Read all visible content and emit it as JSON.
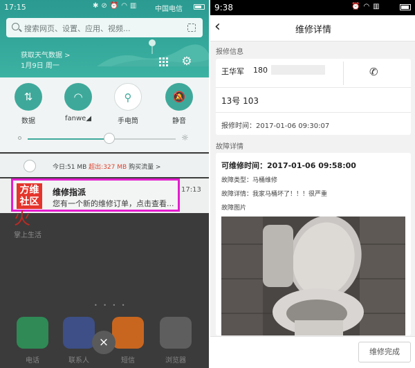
{
  "left_phone": {
    "status": {
      "time": "17:15",
      "carrier": "中国电信"
    },
    "search": {
      "placeholder": "搜索网页、设置、应用、视频..."
    },
    "weather_link": "获取天气数据 >",
    "date": "1月9日 周一",
    "quick_settings": [
      {
        "label": "数据",
        "active": true,
        "icon": "data-arrows-icon"
      },
      {
        "label": "fanwe",
        "active": true,
        "icon": "wifi-icon"
      },
      {
        "label": "手电筒",
        "active": false,
        "icon": "flashlight-icon"
      },
      {
        "label": "静音",
        "active": true,
        "icon": "bell-mute-icon"
      }
    ],
    "brightness": 0.55,
    "data_usage": {
      "today": "今日:51 MB",
      "exceeded": "超出:327 MB",
      "buy": "购买流量 >",
      "warn_color": "#e0422e"
    },
    "notification": {
      "app_logo": "方维社区",
      "title": "维修指派",
      "body": "您有一个新的维修订单，点击查看...",
      "time": "17:13",
      "highlight_color": "#e51ccf"
    },
    "background_app": {
      "name": "掌上生活"
    },
    "dock": [
      {
        "label": "电话",
        "color": "#2f8a55",
        "icon": "phone-icon"
      },
      {
        "label": "联系人",
        "color": "#3d4f86",
        "icon": "contacts-icon"
      },
      {
        "label": "短信",
        "color": "#c8661f",
        "icon": "message-icon"
      },
      {
        "label": "浏览器",
        "color": "#5e5e5e",
        "icon": "browser-icon"
      }
    ],
    "close_label": "×"
  },
  "right_phone": {
    "status": {
      "time": "9:38"
    },
    "header": {
      "title": "维修详情"
    },
    "report_section": "报修信息",
    "reporter": {
      "name": "王华军",
      "phone": "180"
    },
    "room": "13号 103",
    "report_time": "报修时间：2017-01-06 09:30:07",
    "fault_section": "故障详情",
    "available_time": "可维修时间：2017-01-06 09:58:00",
    "fault_type": "故障类型：马桶维修",
    "fault_detail": "故障详情：我家马桶坏了！！！很严重",
    "fault_images_label": "故障图片",
    "done_button": "维修完成"
  }
}
